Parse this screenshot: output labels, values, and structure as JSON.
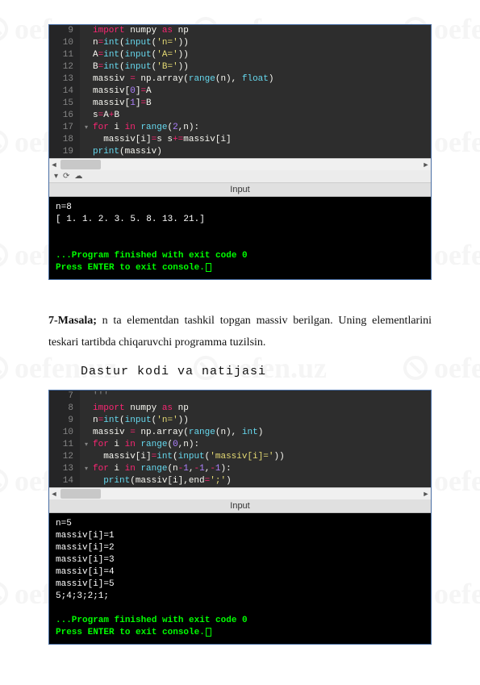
{
  "watermark_text": "oefen.uz",
  "code1": {
    "lines": [
      {
        "n": "9",
        "tokens": [
          [
            "kw",
            "import"
          ],
          [
            "var",
            " numpy "
          ],
          [
            "kw",
            "as"
          ],
          [
            "var",
            " np"
          ]
        ]
      },
      {
        "n": "10",
        "tokens": [
          [
            "var",
            "n"
          ],
          [
            "op",
            "="
          ],
          [
            "fn",
            "int"
          ],
          [
            "var",
            "("
          ],
          [
            "fn",
            "input"
          ],
          [
            "var",
            "("
          ],
          [
            "str",
            "'n='"
          ],
          [
            "var",
            "))"
          ]
        ]
      },
      {
        "n": "11",
        "tokens": [
          [
            "var",
            "A"
          ],
          [
            "op",
            "="
          ],
          [
            "fn",
            "int"
          ],
          [
            "var",
            "("
          ],
          [
            "fn",
            "input"
          ],
          [
            "var",
            "("
          ],
          [
            "str",
            "'A='"
          ],
          [
            "var",
            "))"
          ]
        ]
      },
      {
        "n": "12",
        "tokens": [
          [
            "var",
            "B"
          ],
          [
            "op",
            "="
          ],
          [
            "fn",
            "int"
          ],
          [
            "var",
            "("
          ],
          [
            "fn",
            "input"
          ],
          [
            "var",
            "("
          ],
          [
            "str",
            "'B='"
          ],
          [
            "var",
            "))"
          ]
        ]
      },
      {
        "n": "13",
        "tokens": [
          [
            "var",
            "massiv "
          ],
          [
            "op",
            "="
          ],
          [
            "var",
            " np.array("
          ],
          [
            "fn",
            "range"
          ],
          [
            "var",
            "(n), "
          ],
          [
            "fn",
            "float"
          ],
          [
            "var",
            ")"
          ]
        ]
      },
      {
        "n": "14",
        "tokens": [
          [
            "var",
            "massiv["
          ],
          [
            "num",
            "0"
          ],
          [
            "var",
            "]"
          ],
          [
            "op",
            "="
          ],
          [
            "var",
            "A"
          ]
        ]
      },
      {
        "n": "15",
        "tokens": [
          [
            "var",
            "massiv["
          ],
          [
            "num",
            "1"
          ],
          [
            "var",
            "]"
          ],
          [
            "op",
            "="
          ],
          [
            "var",
            "B"
          ]
        ]
      },
      {
        "n": "16",
        "tokens": [
          [
            "var",
            "s"
          ],
          [
            "op",
            "="
          ],
          [
            "var",
            "A"
          ],
          [
            "op",
            "+"
          ],
          [
            "var",
            "B"
          ]
        ]
      },
      {
        "n": "17",
        "fold": true,
        "tokens": [
          [
            "kw",
            "for"
          ],
          [
            "var",
            " i "
          ],
          [
            "kw",
            "in"
          ],
          [
            "var",
            " "
          ],
          [
            "fn",
            "range"
          ],
          [
            "var",
            "("
          ],
          [
            "num",
            "2"
          ],
          [
            "var",
            ",n):"
          ]
        ]
      },
      {
        "n": "18",
        "tokens": [
          [
            "var",
            "  massiv[i]"
          ],
          [
            "op",
            "="
          ],
          [
            "var",
            "s s"
          ],
          [
            "op",
            "+="
          ],
          [
            "var",
            "massiv[i]"
          ]
        ]
      },
      {
        "n": "19",
        "tokens": [
          [
            "fn",
            "print"
          ],
          [
            "var",
            "(massiv)"
          ]
        ]
      }
    ]
  },
  "toolbar": {
    "icon1": "▾",
    "icon2": "⟳",
    "icon3": "☁"
  },
  "tab1": "Input",
  "console1": {
    "lines": [
      "n=8",
      "[ 1.  1.  2.  3.  5.  8. 13. 21.]",
      "",
      "",
      "...Program finished with exit code 0",
      "Press ENTER to exit console."
    ]
  },
  "prose": {
    "label": "7-Masala;",
    "text": " n ta elementdan tashkil topgan massiv berilgan. Uning elementlarini teskari tartibda chiqaruvchi programma tuzilsin."
  },
  "subheader": "Dastur kodi va natijasi",
  "code2": {
    "lines": [
      {
        "n": "7",
        "tokens": [
          [
            "comment",
            "'''"
          ]
        ]
      },
      {
        "n": "8",
        "tokens": [
          [
            "kw",
            "import"
          ],
          [
            "var",
            " numpy "
          ],
          [
            "kw",
            "as"
          ],
          [
            "var",
            " np"
          ]
        ]
      },
      {
        "n": "9",
        "tokens": [
          [
            "var",
            "n"
          ],
          [
            "op",
            "="
          ],
          [
            "fn",
            "int"
          ],
          [
            "var",
            "("
          ],
          [
            "fn",
            "input"
          ],
          [
            "var",
            "("
          ],
          [
            "str",
            "'n='"
          ],
          [
            "var",
            "))"
          ]
        ]
      },
      {
        "n": "10",
        "tokens": [
          [
            "var",
            "massiv "
          ],
          [
            "op",
            "="
          ],
          [
            "var",
            " np.array("
          ],
          [
            "fn",
            "range"
          ],
          [
            "var",
            "(n), "
          ],
          [
            "fn",
            "int"
          ],
          [
            "var",
            ")"
          ]
        ]
      },
      {
        "n": "11",
        "fold": true,
        "tokens": [
          [
            "kw",
            "for"
          ],
          [
            "var",
            " i "
          ],
          [
            "kw",
            "in"
          ],
          [
            "var",
            " "
          ],
          [
            "fn",
            "range"
          ],
          [
            "var",
            "("
          ],
          [
            "num",
            "0"
          ],
          [
            "var",
            ",n):"
          ]
        ]
      },
      {
        "n": "12",
        "tokens": [
          [
            "var",
            "  massiv[i]"
          ],
          [
            "op",
            "="
          ],
          [
            "fn",
            "int"
          ],
          [
            "var",
            "("
          ],
          [
            "fn",
            "input"
          ],
          [
            "var",
            "("
          ],
          [
            "str",
            "'massiv[i]='"
          ],
          [
            "var",
            "))"
          ]
        ]
      },
      {
        "n": "13",
        "fold": true,
        "tokens": [
          [
            "kw",
            "for"
          ],
          [
            "var",
            " i "
          ],
          [
            "kw",
            "in"
          ],
          [
            "var",
            " "
          ],
          [
            "fn",
            "range"
          ],
          [
            "var",
            "(n"
          ],
          [
            "op",
            "-"
          ],
          [
            "num",
            "1"
          ],
          [
            "var",
            ","
          ],
          [
            "op",
            "-"
          ],
          [
            "num",
            "1"
          ],
          [
            "var",
            ","
          ],
          [
            "op",
            "-"
          ],
          [
            "num",
            "1"
          ],
          [
            "var",
            "):"
          ]
        ]
      },
      {
        "n": "14",
        "tokens": [
          [
            "var",
            "  "
          ],
          [
            "fn",
            "print"
          ],
          [
            "var",
            "(massiv[i],end"
          ],
          [
            "op",
            "="
          ],
          [
            "str",
            "';'"
          ],
          [
            "var",
            ")"
          ]
        ]
      }
    ]
  },
  "tab2": "Input",
  "console2": {
    "lines": [
      "n=5",
      "massiv[i]=1",
      "massiv[i]=2",
      "massiv[i]=3",
      "massiv[i]=4",
      "massiv[i]=5",
      "5;4;3;2;1;",
      "",
      "...Program finished with exit code 0",
      "Press ENTER to exit console."
    ]
  }
}
